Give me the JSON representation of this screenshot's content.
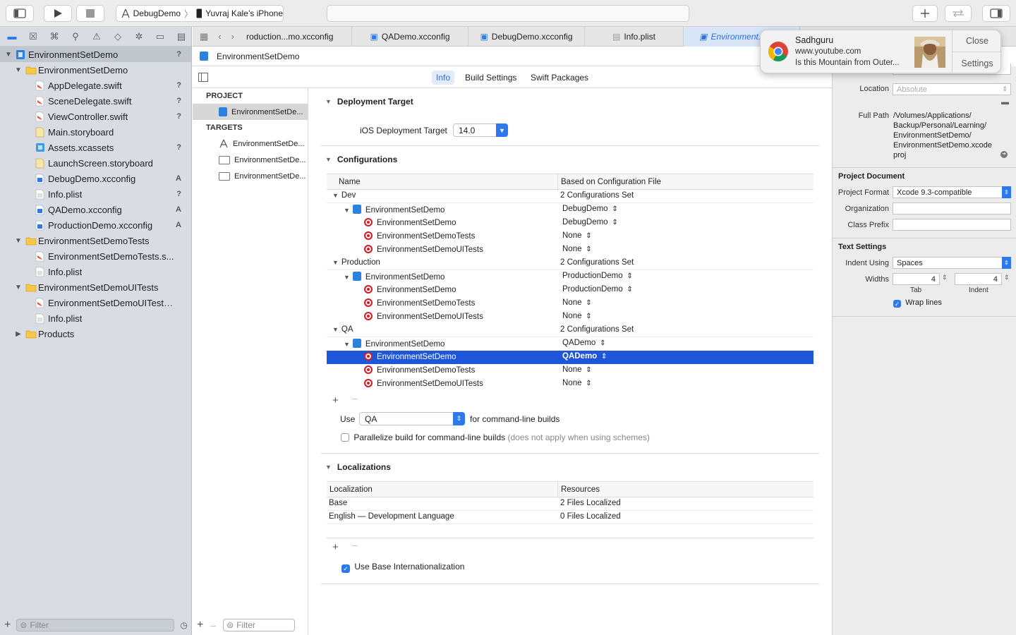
{
  "toolbar": {
    "scheme": "DebugDemo",
    "device": "Yuvraj  Kale’s iPhone"
  },
  "navigator": {
    "items": [
      {
        "label": "EnvironmentSetDemo",
        "badge": "?"
      },
      {
        "label": "EnvironmentSetDemo",
        "badge": ""
      },
      {
        "label": "AppDelegate.swift",
        "badge": "?"
      },
      {
        "label": "SceneDelegate.swift",
        "badge": "?"
      },
      {
        "label": "ViewController.swift",
        "badge": "?"
      },
      {
        "label": "Main.storyboard",
        "badge": ""
      },
      {
        "label": "Assets.xcassets",
        "badge": "?"
      },
      {
        "label": "LaunchScreen.storyboard",
        "badge": ""
      },
      {
        "label": "DebugDemo.xcconfig",
        "badge": "A"
      },
      {
        "label": "Info.plist",
        "badge": "?"
      },
      {
        "label": "QADemo.xcconfig",
        "badge": "A"
      },
      {
        "label": "ProductionDemo.xcconfig",
        "badge": "A"
      },
      {
        "label": "EnvironmentSetDemoTests",
        "badge": ""
      },
      {
        "label": "EnvironmentSetDemoTests.s...",
        "badge": ""
      },
      {
        "label": "Info.plist",
        "badge": ""
      },
      {
        "label": "EnvironmentSetDemoUITests",
        "badge": ""
      },
      {
        "label": "EnvironmentSetDemoUITests....",
        "badge": ""
      },
      {
        "label": "Info.plist",
        "badge": ""
      },
      {
        "label": "Products",
        "badge": ""
      }
    ],
    "filter_placeholder": "Filter"
  },
  "tabs": [
    {
      "label": "roduction...mo.xcconfig"
    },
    {
      "label": "QADemo.xcconfig"
    },
    {
      "label": "DebugDemo.xcconfig"
    },
    {
      "label": "Info.plist"
    },
    {
      "label": "Environment...mo.x"
    }
  ],
  "jumpbar": {
    "label": "EnvironmentSetDemo"
  },
  "segments": {
    "info": "Info",
    "build_settings": "Build Settings",
    "swift_packages": "Swift Packages"
  },
  "project_list": {
    "project_header": "PROJECT",
    "project_item": "EnvironmentSetDe...",
    "targets_header": "TARGETS",
    "targets": [
      "EnvironmentSetDe...",
      "EnvironmentSetDe...",
      "EnvironmentSetDe..."
    ],
    "filter_placeholder": "Filter"
  },
  "deployment": {
    "title": "Deployment Target",
    "label": "iOS Deployment Target",
    "value": "14.0"
  },
  "configurations": {
    "title": "Configurations",
    "col_name": "Name",
    "col_file": "Based on Configuration File",
    "rows": [
      {
        "name": "Dev",
        "file": "2 Configurations Set"
      },
      {
        "name": "EnvironmentSetDemo",
        "file": "DebugDemo"
      },
      {
        "name": "EnvironmentSetDemo",
        "file": "DebugDemo"
      },
      {
        "name": "EnvironmentSetDemoTests",
        "file": "None"
      },
      {
        "name": "EnvironmentSetDemoUITests",
        "file": "None"
      },
      {
        "name": "Production",
        "file": "2 Configurations Set"
      },
      {
        "name": "EnvironmentSetDemo",
        "file": "ProductionDemo"
      },
      {
        "name": "EnvironmentSetDemo",
        "file": "ProductionDemo"
      },
      {
        "name": "EnvironmentSetDemoTests",
        "file": "None"
      },
      {
        "name": "EnvironmentSetDemoUITests",
        "file": "None"
      },
      {
        "name": "QA",
        "file": "2 Configurations Set"
      },
      {
        "name": "EnvironmentSetDemo",
        "file": "QADemo"
      },
      {
        "name": "EnvironmentSetDemo",
        "file": "QADemo"
      },
      {
        "name": "EnvironmentSetDemoTests",
        "file": "None"
      },
      {
        "name": "EnvironmentSetDemoUITests",
        "file": "None"
      }
    ],
    "use_label": "Use",
    "use_value": "QA",
    "use_suffix": "for command-line builds",
    "parallelize_label": "Parallelize build for command-line builds",
    "parallelize_note": "(does not apply when using schemes)"
  },
  "localizations": {
    "title": "Localizations",
    "col_loc": "Localization",
    "col_res": "Resources",
    "rows": [
      {
        "loc": "Base",
        "res": "2 Files Localized"
      },
      {
        "loc": "English — Development Language",
        "res": "0 Files Localized"
      }
    ],
    "base_intl": "Use Base Internationalization"
  },
  "inspector": {
    "location_label": "Location",
    "location_value": "Absolute",
    "fullpath_label": "Full Path",
    "fullpath_lines": [
      "/Volumes/Applications/",
      "Backup/Personal/Learning/",
      "EnvironmentSetDemo/",
      "EnvironmentSetDemo.xcode",
      "proj"
    ],
    "project_document": "Project Document",
    "project_format_label": "Project Format",
    "project_format_value": "Xcode 9.3-compatible",
    "organization_label": "Organization",
    "class_prefix_label": "Class Prefix",
    "text_settings": "Text Settings",
    "indent_using_label": "Indent Using",
    "indent_using_value": "Spaces",
    "widths_label": "Widths",
    "tab_value": "4",
    "indent_value": "4",
    "tab_caption": "Tab",
    "indent_caption": "Indent",
    "wrap_lines": "Wrap lines"
  },
  "notification": {
    "title": "Sadhguru",
    "source": "www.youtube.com",
    "body": "Is this Mountain from Outer...",
    "close": "Close",
    "settings": "Settings"
  },
  "colors": {
    "accent": "#2d78ea",
    "selection": "#1d56d8"
  }
}
